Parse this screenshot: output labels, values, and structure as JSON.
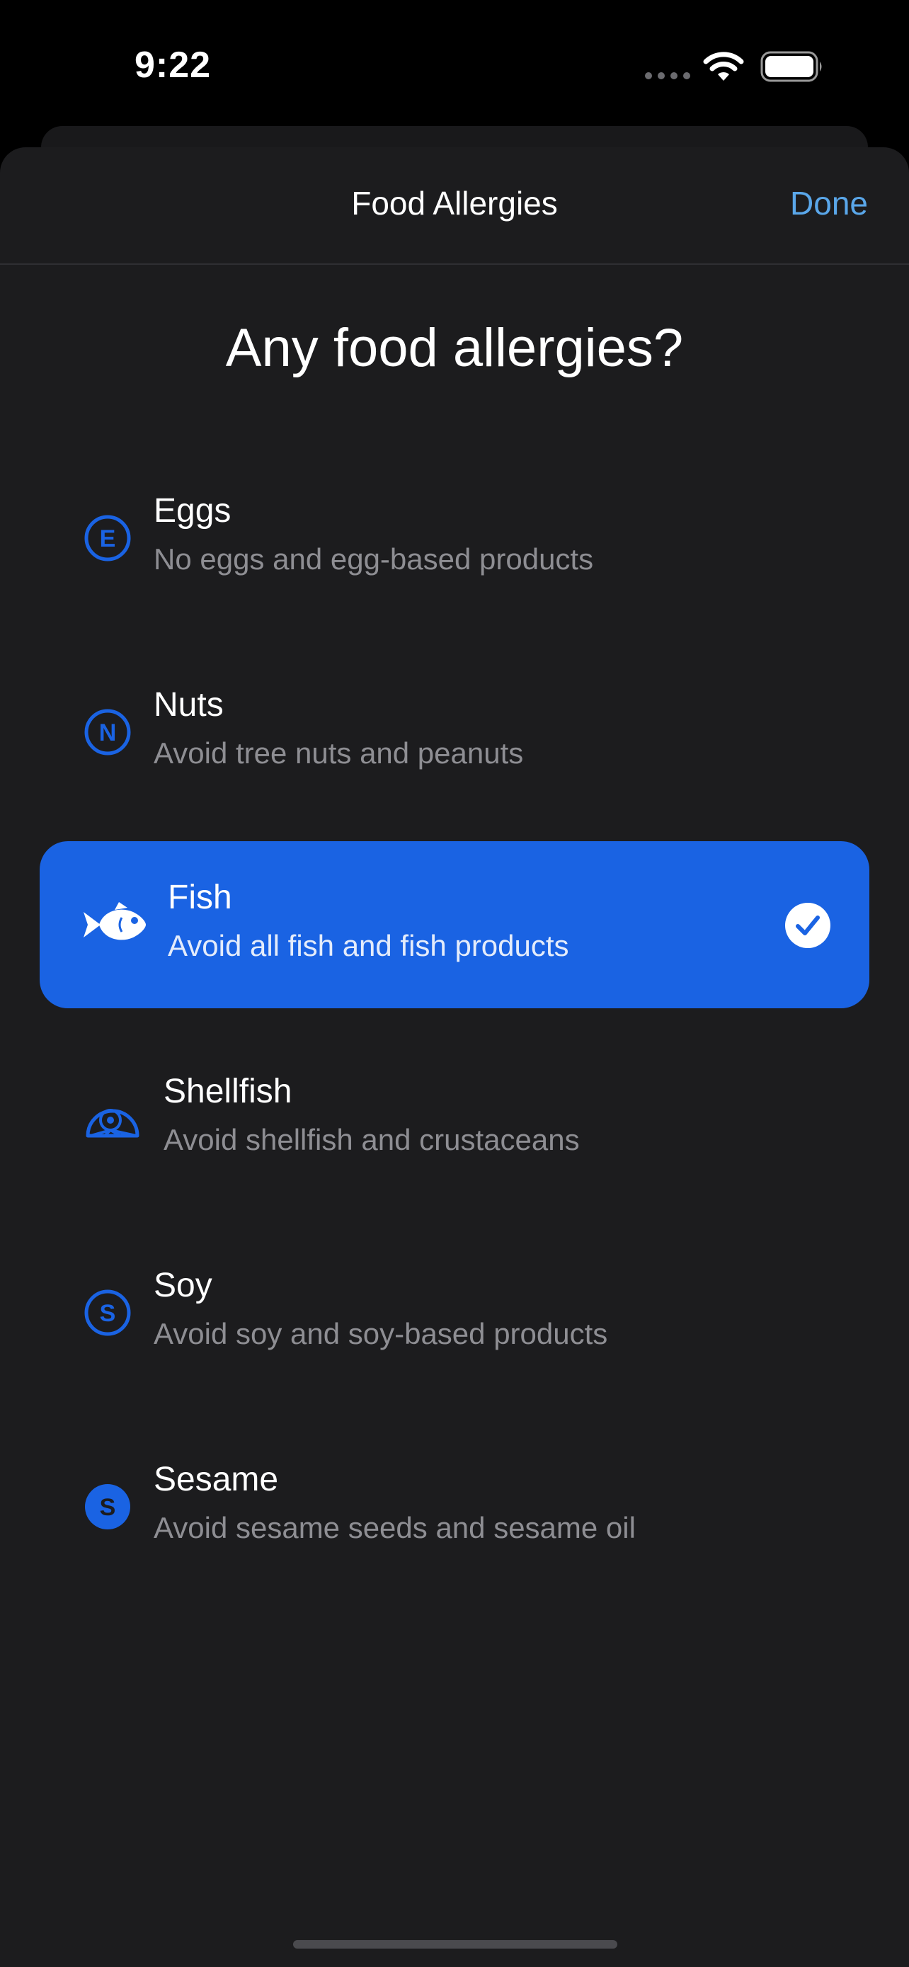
{
  "status_bar": {
    "time": "9:22"
  },
  "nav": {
    "title": "Food Allergies",
    "done_label": "Done"
  },
  "question": "Any food allergies?",
  "options": [
    {
      "title": "Eggs",
      "subtitle": "No eggs and egg-based products",
      "icon": "letter-e-circle-icon",
      "icon_letter": "E",
      "selected": false
    },
    {
      "title": "Nuts",
      "subtitle": "Avoid tree nuts and peanuts",
      "icon": "letter-n-circle-icon",
      "icon_letter": "N",
      "selected": false
    },
    {
      "title": "Fish",
      "subtitle": "Avoid all fish and fish products",
      "icon": "fish-icon",
      "selected": true
    },
    {
      "title": "Shellfish",
      "subtitle": "Avoid shellfish and crustaceans",
      "icon": "shell-icon",
      "selected": false
    },
    {
      "title": "Soy",
      "subtitle": "Avoid soy and soy-based products",
      "icon": "letter-s-circle-icon",
      "icon_letter": "S",
      "selected": false
    },
    {
      "title": "Sesame",
      "subtitle": "Avoid sesame seeds and sesame oil",
      "icon": "letter-s-filled-circle-icon",
      "icon_letter": "S",
      "selected": false
    }
  ],
  "colors": {
    "accent": "#1a63e3",
    "done": "#5aa7ea",
    "sheet_background": "#1c1c1e",
    "subtitle": "#8e8e93"
  }
}
